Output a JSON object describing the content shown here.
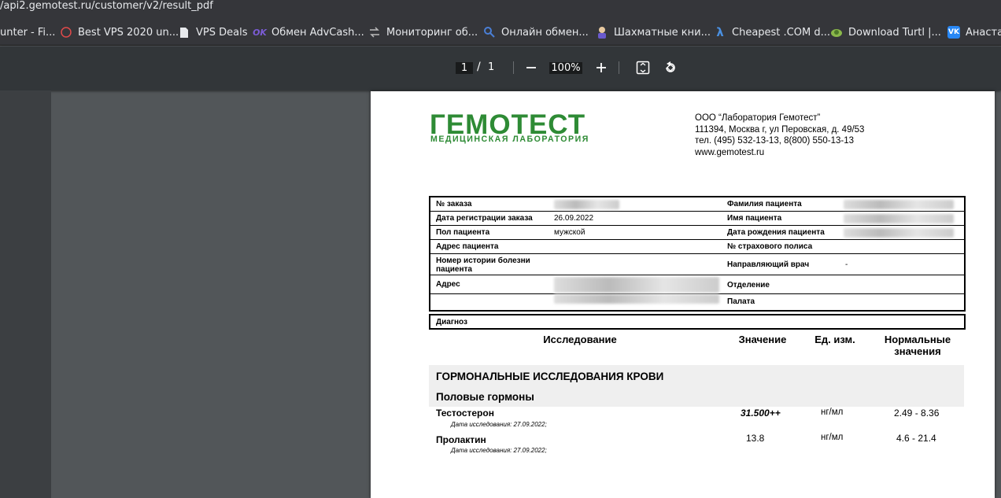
{
  "browser": {
    "url": "/api2.gemotest.ru/customer/v2/result_pdf",
    "bookmarks": [
      {
        "label": "unter - Fi...",
        "icon": "none"
      },
      {
        "label": "Best VPS 2020 un...",
        "icon": "circle-icon"
      },
      {
        "label": "VPS Deals",
        "icon": "document-icon"
      },
      {
        "label": "Обмен AdvCash...",
        "icon": "ok-icon"
      },
      {
        "label": "Мониторинг об...",
        "icon": "swap-icon"
      },
      {
        "label": "Онлайн обмен...",
        "icon": "search-icon"
      },
      {
        "label": "Шахматные кни...",
        "icon": "person-icon"
      },
      {
        "label": "Cheapest .COM d...",
        "icon": "lambda-icon"
      },
      {
        "label": "Download Turtl |...",
        "icon": "turtle-icon"
      },
      {
        "label": "Анаста",
        "icon": "vk-icon"
      }
    ]
  },
  "pdf_toolbar": {
    "page_current": "1",
    "page_separator": "/",
    "page_total": "1",
    "zoom": "100%"
  },
  "document": {
    "logo_main": "ГЕМОТЕСТ",
    "logo_sub": "МЕДИЦИНСКАЯ ЛАБОРАТОРИЯ",
    "org_lines": [
      "ООО “Лаборатория Гемотест”",
      "111394, Москва г, ул Перовская, д. 49/53",
      "тел. (495) 532-13-13, 8(800) 550-13-13",
      "www.gemotest.ru"
    ],
    "info": {
      "order_no_label": "№ заказа",
      "reg_date_label": "Дата регистрации заказа",
      "reg_date_value": "26.09.2022",
      "sex_label": "Пол пациента",
      "sex_value": "мужской",
      "address_patient_label": "Адрес пациента",
      "history_label": "Номер истории болезни пациента",
      "address_label": "Адрес",
      "surname_label": "Фамилия пациента",
      "name_label": "Имя пациента",
      "birth_label": "Дата рождения пациента",
      "policy_label": "№ страхового полиса",
      "doctor_label": "Направляющий врач",
      "doctor_value": "-",
      "department_label": "Отделение",
      "ward_label": "Палата",
      "diagnosis_label": "Диагноз"
    },
    "columns": {
      "study": "Исследование",
      "value": "Значение",
      "unit": "Ед. изм.",
      "norm": "Нормальные значения"
    },
    "section_title": "ГОРМОНАЛЬНЫЕ ИССЛЕДОВАНИЯ КРОВИ",
    "subsection_title": "Половые гормоны",
    "tests": [
      {
        "name": "Тестостерон",
        "date": "Дата исследования: 27.09.2022;",
        "value": "31.500++",
        "unit": "нг/мл",
        "norm": "2.49 - 8.36"
      },
      {
        "name": "Пролактин",
        "date": "Дата исследования: 27.09.2022;",
        "value": "13.8",
        "unit": "нг/мл",
        "norm": "4.6 - 21.4"
      }
    ]
  }
}
